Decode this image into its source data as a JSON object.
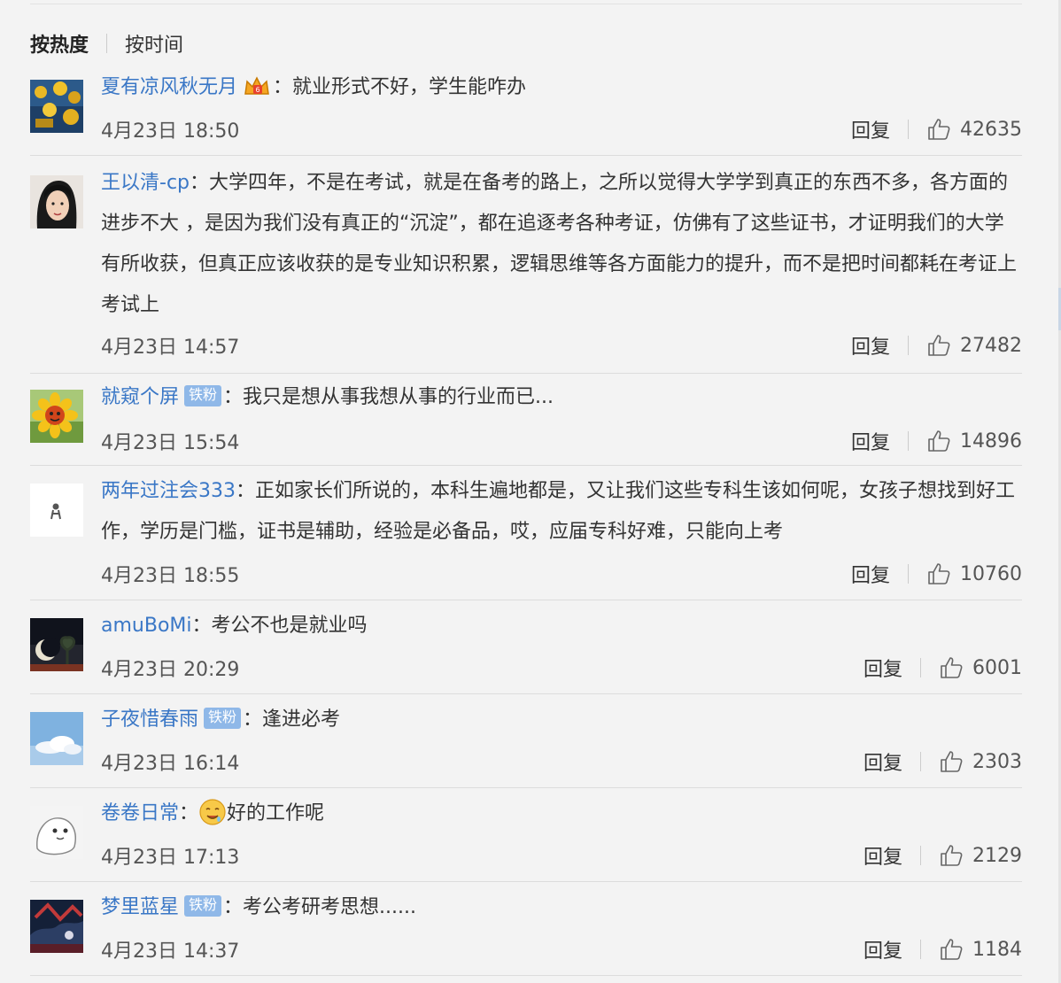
{
  "sort": {
    "hot": "按热度",
    "time": "按时间"
  },
  "reply_label": "回复",
  "comments": [
    {
      "user": "夏有凉风秋无月",
      "badge": "",
      "text": "：就业形式不好，学生能咋办",
      "time": "4月23日 18:50",
      "likes": "42635"
    },
    {
      "user": "王以清-cp",
      "badge": "",
      "text": "：大学四年，不是在考试，就是在备考的路上，之所以觉得大学学到真正的东西不多，各方面的进步不大 ，是因为我们没有真正的“沉淀”，都在追逐考各种考证，仿佛有了这些证书，才证明我们的大学有所收获，但真正应该收获的是专业知识积累，逻辑思维等各方面能力的提升，而不是把时间都耗在考证上考试上",
      "time": "4月23日 14:57",
      "likes": "27482"
    },
    {
      "user": "就窥个屏",
      "badge": "铁粉",
      "text": "：我只是想从事我想从事的行业而已...",
      "time": "4月23日 15:54",
      "likes": "14896"
    },
    {
      "user": "两年过注会333",
      "badge": "",
      "text": "：正如家长们所说的，本科生遍地都是，又让我们这些专科生该如何呢，女孩子想找到好工作，学历是门槛，证书是辅助，经验是必备品，哎，应届专科好难，只能向上考",
      "time": "4月23日 18:55",
      "likes": "10760"
    },
    {
      "user": "amuBoMi",
      "badge": "",
      "text": "：考公不也是就业吗",
      "time": "4月23日 20:29",
      "likes": "6001"
    },
    {
      "user": "子夜惜春雨",
      "badge": "铁粉",
      "text": "：逢进必考",
      "time": "4月23日 16:14",
      "likes": "2303"
    },
    {
      "user": "卷卷日常",
      "badge": "",
      "text": "好的工作呢",
      "time": "4月23日 17:13",
      "likes": "2129"
    },
    {
      "user": "梦里蓝星",
      "badge": "铁粉",
      "text": "：考公考研考思想......",
      "time": "4月23日 14:37",
      "likes": "1184"
    }
  ],
  "icons": {
    "like": "thumbs-up-icon",
    "crown": "vip-crown-icon",
    "emoji": "drooling-emoji-icon"
  },
  "colors": {
    "username": "#3a77c6",
    "badge_bg": "#8fb8e8",
    "background": "#f3f3f3"
  }
}
